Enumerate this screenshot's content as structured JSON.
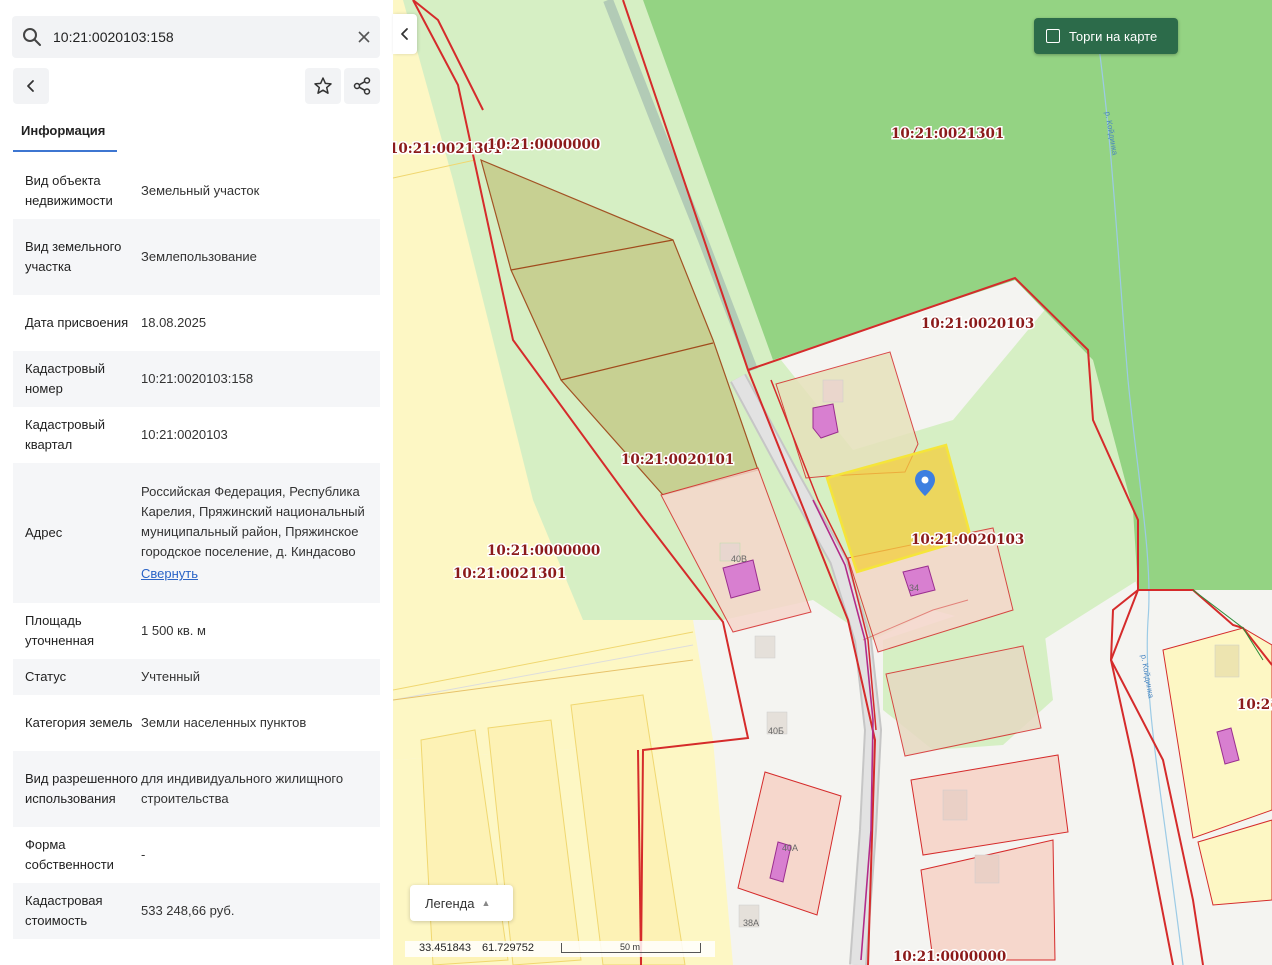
{
  "search": {
    "value": "10:21:0020103:158"
  },
  "panel": {
    "tab_label": "Информация",
    "rows": [
      {
        "key": "Вид объекта недвижимости",
        "value": "Земельный участок"
      },
      {
        "key": "Вид земельного участка",
        "value": "Землепользование"
      },
      {
        "key": "Дата присвоения",
        "value": "18.08.2025"
      },
      {
        "key": "Кадастровый номер",
        "value": "10:21:0020103:158"
      },
      {
        "key": "Кадастровый квартал",
        "value": "10:21:0020103"
      },
      {
        "key": "Адрес",
        "value": "Российская Федерация, Республика Карелия, Пряжинский национальный муниципальный район, Пряжинское городское поселение, д. Киндасово",
        "link": "Свернуть"
      },
      {
        "key": "Площадь уточненная",
        "value": "1 500 кв. м"
      },
      {
        "key": "Статус",
        "value": "Учтенный"
      },
      {
        "key": "Категория земель",
        "value": "Земли населенных пунктов"
      },
      {
        "key": "Вид разрешенного использования",
        "value": "для индивидуального жилищного строительства"
      },
      {
        "key": "Форма собственности",
        "value": "-"
      },
      {
        "key": "Кадастровая стоимость",
        "value": "533 248,66 руб."
      }
    ]
  },
  "map": {
    "torgi_label": "Торги на карте",
    "legend_label": "Легенда",
    "coord_lon": "33.451843",
    "coord_lat": "61.729752",
    "scale_label": "50 m",
    "labels": [
      "10:21:0021301",
      "10:21:0000000",
      "10:21:0021301",
      "10:21:0020103",
      "10:21:0020101",
      "10:21:0000000",
      "10:21:0021301",
      "10:21:0020103",
      "10:21:0000000",
      "10:21"
    ],
    "house_numbers": [
      "40В",
      "40Б",
      "40А",
      "38А",
      "34"
    ],
    "river_labels": [
      "р. Койдинка",
      "р. Койдинка"
    ]
  },
  "colors": {
    "forest": "#94d383",
    "meadow": "#d6efc4",
    "residential": "#fdf7c4",
    "parcel_fill": "#f6d7cc",
    "boundary": "#d52b2b",
    "selected": "#f3cd3b",
    "marker": "#3d7fe0",
    "accent_button": "#2c6b4a"
  }
}
